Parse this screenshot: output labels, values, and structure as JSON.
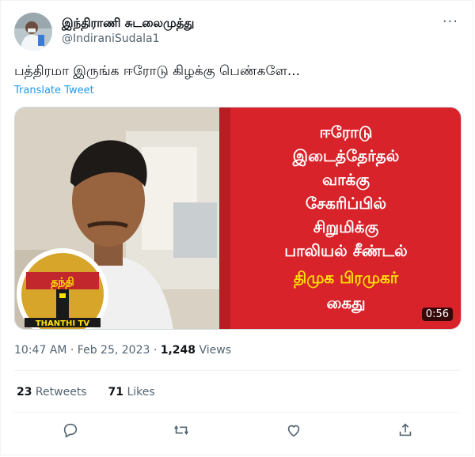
{
  "author": {
    "display_name": "இந்திராணி சுடலைமுத்து",
    "handle": "@IndiraniSudala1"
  },
  "tweet": {
    "text": "பத்திரமா இருங்க ஈரோடு கிழக்கு பெண்களே...",
    "translate_label": "Translate Tweet"
  },
  "media": {
    "poster_lines": [
      "ஈரோடு",
      "இடைத்தேர்தல்",
      "வாக்கு",
      "சேகரிப்பில்",
      "சிறுமிக்கு",
      "பாலியல் சீண்டல்"
    ],
    "poster_highlight_lines": [
      "திமுக பிரமுகர்",
      "கைது"
    ],
    "logo_top": "தந்தி",
    "logo_bottom": "THANTHI TV",
    "duration": "0:56",
    "colors": {
      "poster_red": "#d8232a",
      "highlight_yellow": "#ffe100"
    }
  },
  "meta": {
    "time_date": "10:47 AM · Feb 25, 2023 · ",
    "views_count": "1,248",
    "views_label": " Views"
  },
  "stats": {
    "retweets_count": "23",
    "retweets_label": " Retweets",
    "likes_count": "71",
    "likes_label": " Likes"
  },
  "actions": {
    "icons": [
      "reply-icon",
      "retweet-icon",
      "like-icon",
      "share-icon"
    ]
  }
}
